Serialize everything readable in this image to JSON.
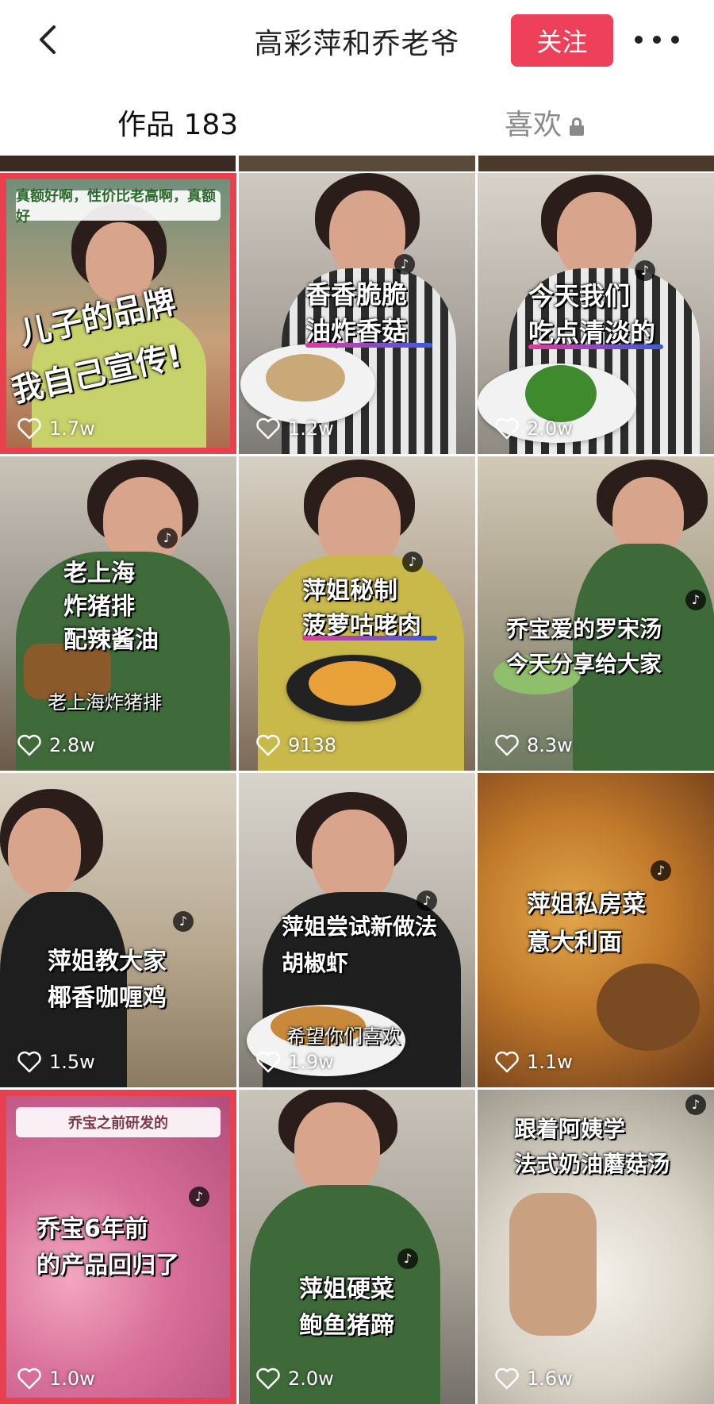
{
  "header": {
    "back_label": "back",
    "title": "高彩萍和乔老爷",
    "follow_label": "关注",
    "more_label": "more"
  },
  "tabs": [
    {
      "label": "作品 183",
      "active": true
    },
    {
      "label": "喜欢",
      "locked": true
    }
  ],
  "colors": {
    "accent": "#ee4058",
    "highlight": "#e8404f"
  },
  "videos": [
    {
      "caption": [
        "儿子的品牌",
        "我自己宣传!"
      ],
      "top_banner": "真额好啊，性价比老高啊，真额好",
      "likes": "1.7w"
    },
    {
      "caption": [
        "香香脆脆",
        "油炸香菇"
      ],
      "likes": "1.2w"
    },
    {
      "caption": [
        "今天我们",
        "吃点清淡的"
      ],
      "likes": "2.0w"
    },
    {
      "caption": [
        "老上海",
        "炸猪排",
        "配辣酱油"
      ],
      "subcaption": "老上海炸猪排",
      "likes": "2.8w"
    },
    {
      "caption": [
        "萍姐秘制",
        "菠萝咕咾肉"
      ],
      "likes": "9138"
    },
    {
      "caption": [
        "乔宝爱的罗宋汤",
        "今天分享给大家"
      ],
      "likes": "8.3w"
    },
    {
      "caption": [
        "萍姐教大家",
        "椰香咖喱鸡"
      ],
      "likes": "1.5w"
    },
    {
      "caption": [
        "萍姐尝试新做法",
        "胡椒虾"
      ],
      "subcaption": "希望你们喜欢",
      "likes": "1.9w"
    },
    {
      "caption": [
        "萍姐私房菜",
        "意大利面"
      ],
      "likes": "1.1w"
    },
    {
      "caption": [
        "乔宝6年前",
        "的产品回归了"
      ],
      "top_banner": "乔宝之前研发的",
      "likes": "1.0w"
    },
    {
      "caption": [
        "萍姐硬菜",
        "鲍鱼猪蹄"
      ],
      "likes": "2.0w"
    },
    {
      "caption": [
        "跟着阿姨学",
        "法式奶油蘑菇汤"
      ],
      "likes": "1.6w"
    }
  ]
}
